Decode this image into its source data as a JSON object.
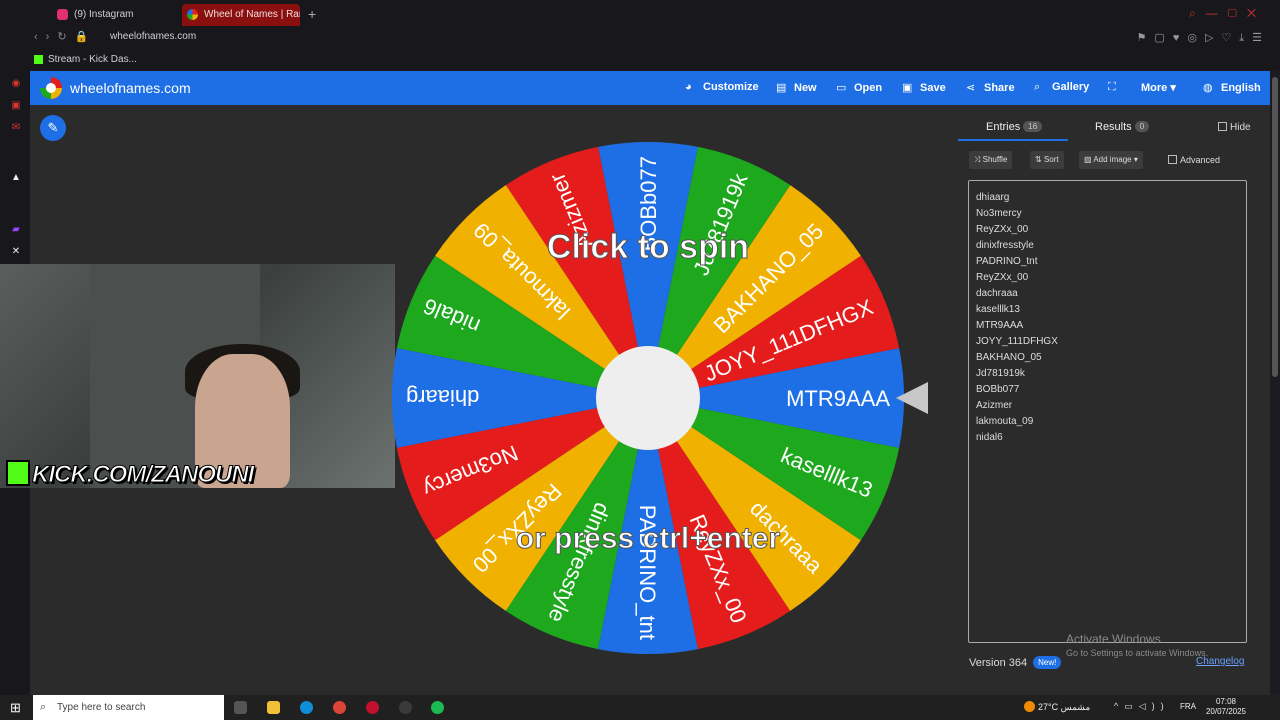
{
  "browser": {
    "tabs": [
      {
        "label": "(9) Instagram",
        "icon": "instagram-icon",
        "color": "#e1306c"
      },
      {
        "label": "Wheel of Names | Random",
        "icon": "wheel-icon",
        "color": "#1e6fe6"
      }
    ],
    "new_tab": "+",
    "url": "wheelofnames.com",
    "bookmark": "Stream - Kick Das..."
  },
  "header": {
    "site_name": "wheelofnames.com",
    "buttons": {
      "customize": "Customize",
      "new": "New",
      "open": "Open",
      "save": "Save",
      "share": "Share",
      "gallery": "Gallery",
      "more": "More",
      "language": "English"
    },
    "colors": {
      "bar": "#1e6fe6"
    }
  },
  "overlay": {
    "kick": "KICK.COM/ZANOUNI"
  },
  "wheel": {
    "line1": "Click to spin",
    "line2": "or press ctrl+enter",
    "segment_colors": [
      "#1e6fe6",
      "#e51c1c",
      "#f0b100",
      "#1da81d"
    ],
    "segments": [
      "MTR9AAA",
      "JOYY_111DFHGX",
      "BAKHANO_05",
      "Jd781919k",
      "BOBb077",
      "Azizmer",
      "lakmouta_09",
      "nidal6",
      "dhiaarg",
      "No3mercy",
      "ReyZXx_00",
      "dinixfresstyle",
      "PADRINO_tnt",
      "ReyZXx_00",
      "dachraaa",
      "kaselllk13"
    ]
  },
  "panel": {
    "tab_entries": "Entries",
    "entries_count": "16",
    "tab_results": "Results",
    "results_count": "0",
    "hide": "Hide",
    "shuffle": "Shuffle",
    "sort": "Sort",
    "add_image": "Add image",
    "advanced": "Advanced",
    "entries": [
      "dhiaarg",
      "No3mercy",
      "ReyZXx_00",
      "dinixfresstyle",
      "PADRINO_tnt",
      "ReyZXx_00",
      "dachraaa",
      "kaselllk13",
      "MTR9AAA",
      "JOYY_111DFHGX",
      "BAKHANO_05",
      "Jd781919k",
      "BOBb077",
      "Azizmer",
      "lakmouta_09",
      "nidal6"
    ],
    "version": "Version 364",
    "new_badge": "New!",
    "changelog": "Changelog"
  },
  "windows_notice": {
    "title": "Activate Windows",
    "subtitle": "Go to Settings to activate Windows."
  },
  "taskbar": {
    "search_placeholder": "Type here to search",
    "weather": "27°C  مشمس",
    "language": "FRA",
    "time": "07:08",
    "date": "20/07/2025"
  }
}
